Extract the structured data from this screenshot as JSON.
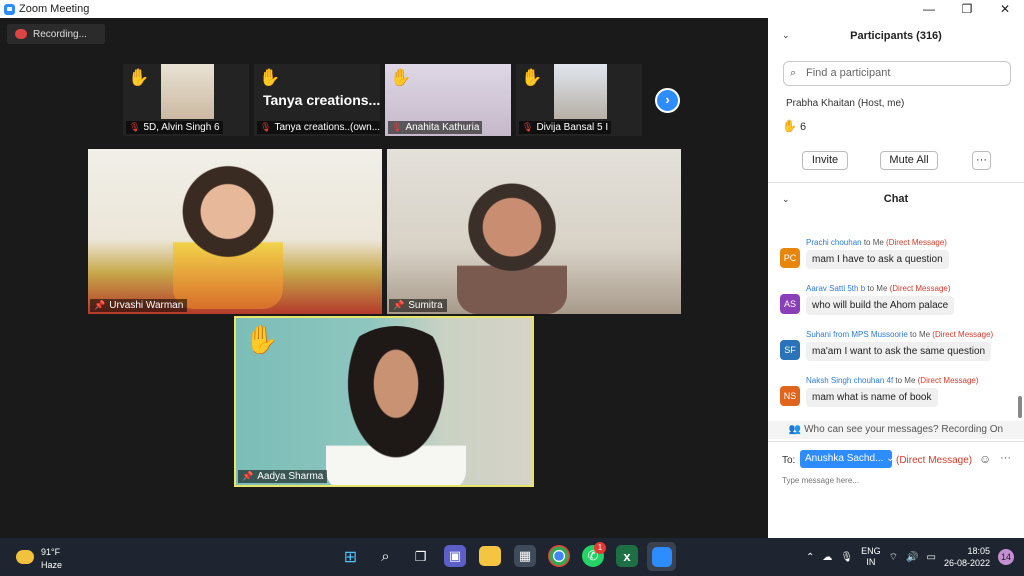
{
  "window": {
    "title": "Zoom Meeting",
    "minimize": "—",
    "restore": "❐",
    "close": "✕"
  },
  "recording": {
    "label": "Recording..."
  },
  "thumbnails": [
    {
      "name": "5D, Alvin Singh 6",
      "big_text": ""
    },
    {
      "name": "Tanya creations..(own...",
      "big_text": "Tanya  creations..."
    },
    {
      "name": "Anahita Kathuria",
      "big_text": ""
    },
    {
      "name": "Divija Bansal 5 I",
      "big_text": ""
    }
  ],
  "videos": [
    {
      "name": "Urvashi Warman"
    },
    {
      "name": "Sumitra"
    },
    {
      "name": "Aadya Sharma"
    }
  ],
  "participants": {
    "title": "Participants (316)",
    "search_placeholder": "Find a participant",
    "partial_row": "Prabha Khaitan      (Host, me)",
    "raised_hands": "6",
    "invite": "Invite",
    "mute_all": "Mute All",
    "more": "···"
  },
  "chat": {
    "title": "Chat",
    "messages": [
      {
        "initials": "PC",
        "from": "Prachi chouhan",
        "to": " to Me ",
        "dm": "(Direct Message)",
        "text": "mam I have to ask a question",
        "color": "#e8860c"
      },
      {
        "initials": "AS",
        "from": "Aarav Satti 5th b",
        "to": " to Me ",
        "dm": "(Direct Message)",
        "text": "who will build the Ahom palace",
        "color": "#8a3fb8"
      },
      {
        "initials": "SF",
        "from": "Suhani from MPS Mussoorie",
        "to": " to Me ",
        "dm": "(Direct Message)",
        "text": "ma'am I want to ask the same question",
        "color": "#2a73b8"
      },
      {
        "initials": "NS",
        "from": "Naksh Singh chouhan 4f",
        "to": " to Me ",
        "dm": "(Direct Message)",
        "text": "mam what is name of book",
        "color": "#e0651c"
      }
    ],
    "privacy_note": "Who can see your messages? Recording On",
    "to_label": "To:",
    "recipient": "Anushka Sachd...",
    "dm_tag": "(Direct Message)",
    "placeholder": "Type message here..."
  },
  "taskbar": {
    "temp": "91°F",
    "condition": "Haze",
    "lang1": "ENG",
    "lang2": "IN",
    "time": "18:05",
    "date": "26-08-2022",
    "notifications": "14",
    "whatsapp_badge": "1"
  }
}
